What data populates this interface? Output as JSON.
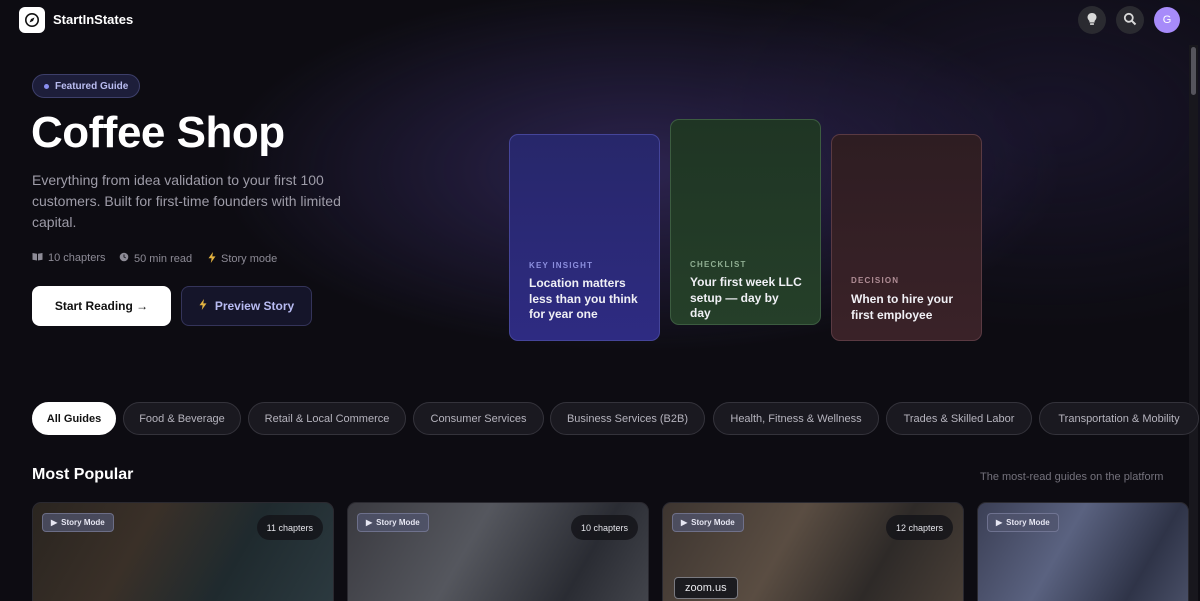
{
  "app": {
    "name": "StartInStates",
    "avatar_initial": "G"
  },
  "header": {
    "icons": [
      "lightbulb-icon",
      "search-icon"
    ]
  },
  "hero": {
    "badge": "Featured Guide",
    "title": "Coffee Shop",
    "description": "Everything from idea validation to your first 100 customers. Built for first-time founders with limited capital.",
    "meta": {
      "chapters": "10 chapters",
      "read_time": "50 min read",
      "mode": "Story mode"
    },
    "primary_button": "Start Reading →",
    "secondary_button": "Preview Story"
  },
  "story_cards": [
    {
      "kicker": "KEY INSIGHT",
      "text": "Location matters less than you think for year one",
      "accent": "#8d90e0"
    },
    {
      "kicker": "CHECKLIST",
      "text": "Your first week LLC setup — day by day",
      "accent": "#8fae92"
    },
    {
      "kicker": "DECISION",
      "text": "When to hire your first employee",
      "accent": "#b08d95"
    }
  ],
  "categories": [
    "All Guides",
    "Food & Beverage",
    "Retail & Local Commerce",
    "Consumer Services",
    "Business Services (B2B)",
    "Health, Fitness & Wellness",
    "Trades & Skilled Labor",
    "Transportation & Mobility"
  ],
  "popular": {
    "title": "Most Popular",
    "subtitle": "The most-read guides on the platform",
    "cards": [
      {
        "mode": "Story Mode",
        "chapters": "11 chapters"
      },
      {
        "mode": "Story Mode",
        "chapters": "10 chapters"
      },
      {
        "mode": "Story Mode",
        "chapters": "12 chapters"
      },
      {
        "mode": "Story Mode",
        "chapters": ""
      }
    ]
  },
  "tooltip": "zoom.us"
}
